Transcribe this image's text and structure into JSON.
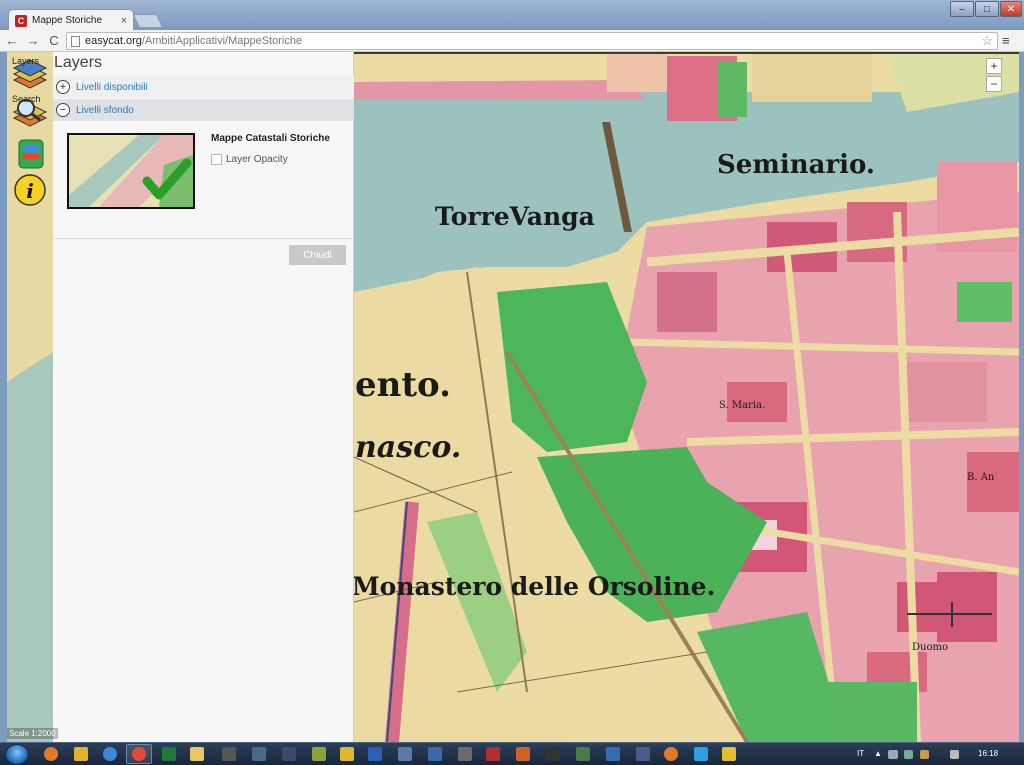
{
  "browser": {
    "tab_title": "Mappe Storiche",
    "tab_close": "×",
    "favicon_letter": "C",
    "url_host": "easycat.org",
    "url_path": "/AmbitiApplicativi/MappeStoriche",
    "back_glyph": "←",
    "forward_glyph": "→",
    "reload_glyph": "C",
    "star_glyph": "☆",
    "menu_glyph": "≡",
    "win_min": "–",
    "win_max": "□",
    "win_close": "✕"
  },
  "sidebar": {
    "layers_label": "Layers",
    "search_label": "Search",
    "icons": [
      "layers-icon",
      "search-icon",
      "legend-icon",
      "info-icon"
    ]
  },
  "panel": {
    "title": "Layers",
    "available": {
      "label": "Livelli disponibili",
      "toggle": "+"
    },
    "background": {
      "label": "Livelli sfondo",
      "toggle": "−"
    },
    "layer_name": "Mappe Catastali Storiche",
    "opacity_label": "Layer Opacity",
    "opacity_checked": false,
    "close_label": "Chiudi"
  },
  "map": {
    "labels": {
      "seminario": "Seminario.",
      "torrevanga": "TorreVanga",
      "ento": "ento.",
      "nasco": "nasco.",
      "monastero": "Monastero delle Orsoline.",
      "santa_maria": "S. Maria.",
      "duomo": "Duomo",
      "ba": "B. An"
    },
    "zoom_in": "+",
    "zoom_out": "−",
    "scale_text": "Scale 1:2000"
  },
  "taskbar": {
    "language": "IT",
    "clock": "16:18"
  },
  "colors": {
    "river": "#9cc2bf",
    "land": "#ecdca3",
    "building": "#dd8597",
    "garden": "#5fbf69",
    "accent_link": "#2b7bc0"
  }
}
